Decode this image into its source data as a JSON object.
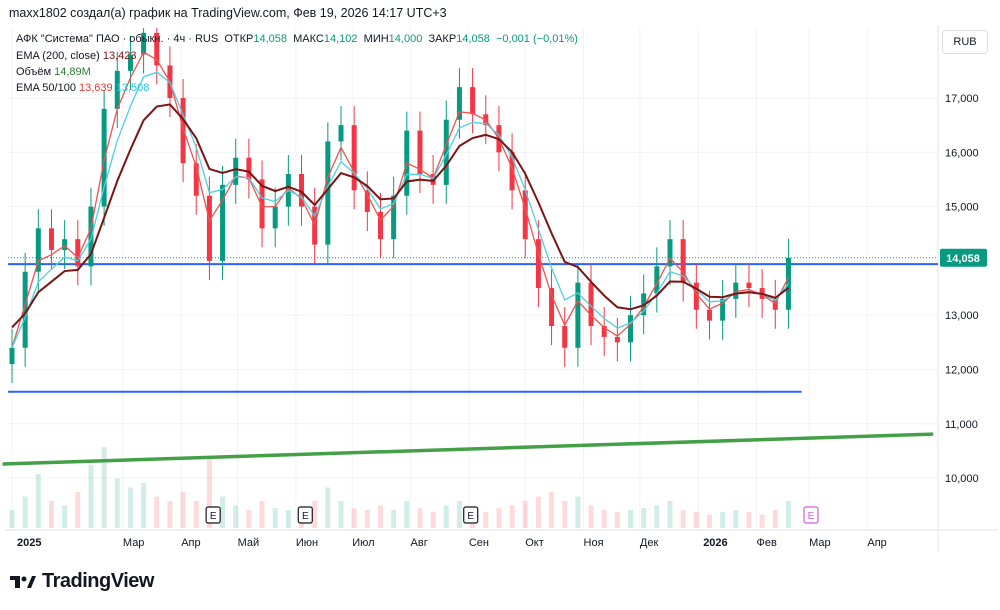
{
  "header": {
    "attribution": "maxx1802 создал(а) график на TradingView.com, Фев 19, 2026 14:17 UTC+3"
  },
  "legend": {
    "symbol": "АФК \"Система\" ПАО · обыкн. · 4ч · RUS",
    "open_label": "ОТКР",
    "open": "14,058",
    "high_label": "МАКС",
    "high": "14,102",
    "low_label": "МИН",
    "low": "14,000",
    "close_label": "ЗАКР",
    "close": "14,058",
    "change": "−0,001 (−0,01%)",
    "ema200_label": "EMA (200, close)",
    "ema200_value": "13,423",
    "volume_label": "Объём",
    "volume_value": "14,89M",
    "ema50_100_label": "EMA 50/100",
    "ema50_value": "13,639",
    "ema100_value": "13,508"
  },
  "currency_button": "RUB",
  "price_label": "14,058",
  "logo": "TradingView",
  "colors": {
    "up": "#089981",
    "down": "#f23645",
    "ema200": "#7b1414",
    "ema50": "#ef5350",
    "ema100": "#4dd0e1",
    "hline": "#2962ff",
    "trend": "#43a047",
    "earn": "#d35fd8"
  },
  "chart_data": {
    "type": "candlestick",
    "title": "АФК \"Система\" ПАО · 4ч",
    "x_unit": "days since 2025-01-01 (weekly samples)",
    "closes": [
      12.4,
      13.8,
      14.6,
      14.2,
      14.4,
      13.9,
      15.0,
      16.8,
      17.5,
      17.8,
      18.2,
      17.6,
      17.0,
      15.8,
      15.2,
      14.0,
      15.4,
      15.9,
      15.5,
      14.6,
      15.0,
      15.6,
      15.0,
      14.3,
      16.2,
      16.5,
      15.3,
      14.9,
      14.4,
      15.2,
      16.4,
      15.6,
      15.4,
      16.6,
      17.2,
      16.7,
      16.5,
      16.0,
      15.3,
      14.4,
      13.5,
      12.8,
      12.4,
      13.6,
      12.8,
      12.6,
      12.5,
      13.0,
      13.4,
      13.9,
      14.4,
      13.6,
      13.1,
      12.9,
      13.3,
      13.6,
      13.5,
      13.3,
      13.1,
      14.058
    ],
    "volume_m": [
      20,
      35,
      60,
      30,
      25,
      40,
      70,
      90,
      55,
      45,
      50,
      35,
      30,
      40,
      30,
      80,
      35,
      25,
      20,
      30,
      22,
      20,
      18,
      30,
      45,
      30,
      22,
      20,
      25,
      20,
      30,
      22,
      18,
      25,
      30,
      20,
      18,
      22,
      25,
      30,
      35,
      40,
      30,
      35,
      25,
      20,
      18,
      20,
      22,
      25,
      30,
      20,
      18,
      15,
      18,
      20,
      18,
      15,
      20,
      30
    ],
    "y_ticks": [
      "17,000",
      "16,000",
      "15,000",
      "14,000",
      "13,000",
      "12,000",
      "11,000",
      "10,000"
    ],
    "y_tick_values": [
      17,
      16,
      15,
      14,
      13,
      12,
      11,
      10
    ],
    "ylim": [
      9.3,
      18.3
    ],
    "x_ticks": [
      {
        "label": "2025",
        "day": 0
      },
      {
        "label": "Мар",
        "day": 59
      },
      {
        "label": "Апр",
        "day": 90
      },
      {
        "label": "Май",
        "day": 120
      },
      {
        "label": "Июн",
        "day": 151
      },
      {
        "label": "Июл",
        "day": 181
      },
      {
        "label": "Авг",
        "day": 212
      },
      {
        "label": "Сен",
        "day": 243
      },
      {
        "label": "Окт",
        "day": 273
      },
      {
        "label": "Ноя",
        "day": 304
      },
      {
        "label": "Дек",
        "day": 334
      },
      {
        "label": "2026",
        "day": 365
      },
      {
        "label": "Фев",
        "day": 396
      },
      {
        "label": "Мар",
        "day": 424
      },
      {
        "label": "Апр",
        "day": 455
      }
    ],
    "horizontal_lines": [
      {
        "price": 13.94,
        "to_day": "end"
      },
      {
        "price": 11.59,
        "to_day": 420
      }
    ],
    "trendline": {
      "from": [
        -5,
        10.26
      ],
      "to": [
        490,
        10.81
      ]
    },
    "last_price": 14.058,
    "earnings": [
      {
        "label": "E",
        "day": 107
      },
      {
        "label": "E",
        "day": 156
      },
      {
        "label": "E",
        "day": 244
      },
      {
        "label": "E",
        "day": 425,
        "upcoming": true
      }
    ]
  }
}
